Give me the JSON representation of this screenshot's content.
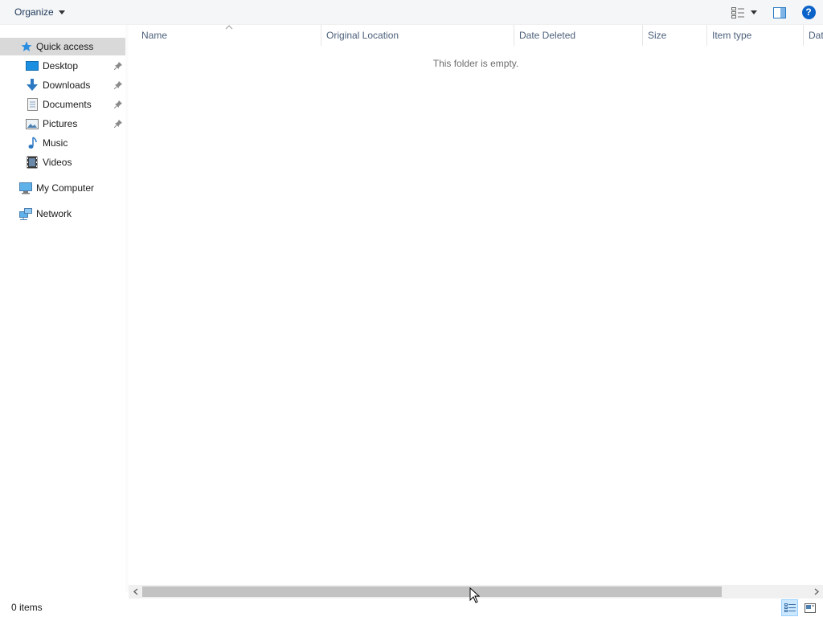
{
  "toolbar": {
    "organize_label": "Organize",
    "icons": [
      "view-options-icon",
      "preview-pane-icon",
      "help-icon"
    ],
    "help_glyph": "?"
  },
  "nav": {
    "items": [
      {
        "label": "Quick access",
        "icon": "star-icon",
        "selected": true
      },
      {
        "label": "Desktop",
        "icon": "desktop-icon",
        "pinned": true
      },
      {
        "label": "Downloads",
        "icon": "downloads-icon",
        "pinned": true
      },
      {
        "label": "Documents",
        "icon": "documents-icon",
        "pinned": true
      },
      {
        "label": "Pictures",
        "icon": "pictures-icon",
        "pinned": true
      },
      {
        "label": "Music",
        "icon": "music-icon"
      },
      {
        "label": "Videos",
        "icon": "videos-icon"
      },
      {
        "label": "My Computer",
        "icon": "computer-icon"
      },
      {
        "label": "Network",
        "icon": "network-icon"
      }
    ]
  },
  "columns": [
    "Name",
    "Original Location",
    "Date Deleted",
    "Size",
    "Item type",
    "Dat"
  ],
  "empty_message": "This folder is empty.",
  "status": {
    "item_count": "0 items"
  },
  "colors": {
    "selected_bg": "#d9d9d9",
    "accent": "#0b63c9",
    "header_text": "#4c607a"
  }
}
